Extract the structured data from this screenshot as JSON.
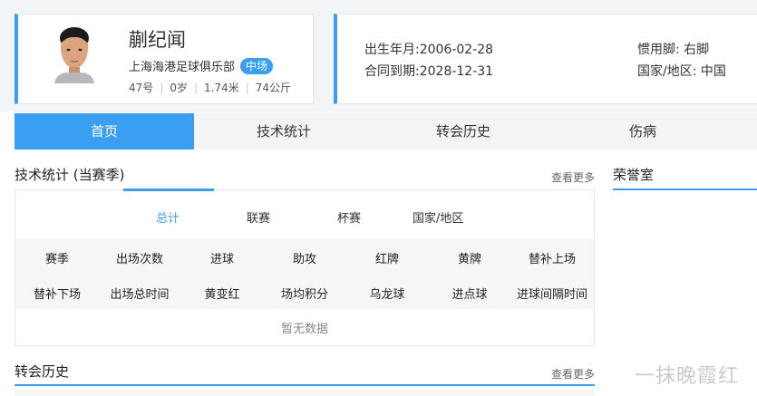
{
  "colors": {
    "accent": "#3a9ff0",
    "panel_bg": "#f3f4f6",
    "border": "#e3e6ea"
  },
  "player": {
    "name": "蒯纪闻",
    "club": "上海海港足球俱乐部",
    "position": "中场",
    "number": "47号",
    "age": "0岁",
    "height": "1.74米",
    "weight": "74公斤"
  },
  "info": {
    "birth_label": "出生年月:",
    "birth_value": "2006-02-28",
    "contract_label": "合同到期:",
    "contract_value": "2028-12-31",
    "foot_label": "惯用脚:",
    "foot_value": "右脚",
    "country_label": "国家/地区:",
    "country_value": "中国"
  },
  "tabs": [
    "首页",
    "技术统计",
    "转会历史",
    "伤病"
  ],
  "stats_section": {
    "title": "技术统计 (当赛季)",
    "more": "查看更多",
    "subtabs": [
      "总计",
      "联赛",
      "杯赛",
      "国家/地区"
    ],
    "row1": [
      "赛季",
      "出场次数",
      "进球",
      "助攻",
      "红牌",
      "黄牌",
      "替补上场"
    ],
    "row2": [
      "替补下场",
      "出场总时间",
      "黄变红",
      "场均积分",
      "乌龙球",
      "进点球",
      "进球间隔时间"
    ],
    "no_data": "暂无数据"
  },
  "honor_section": {
    "title": "荣誉室"
  },
  "transfer_section": {
    "title": "转会历史",
    "more": "查看更多"
  },
  "watermark": "一抹晚霞红"
}
